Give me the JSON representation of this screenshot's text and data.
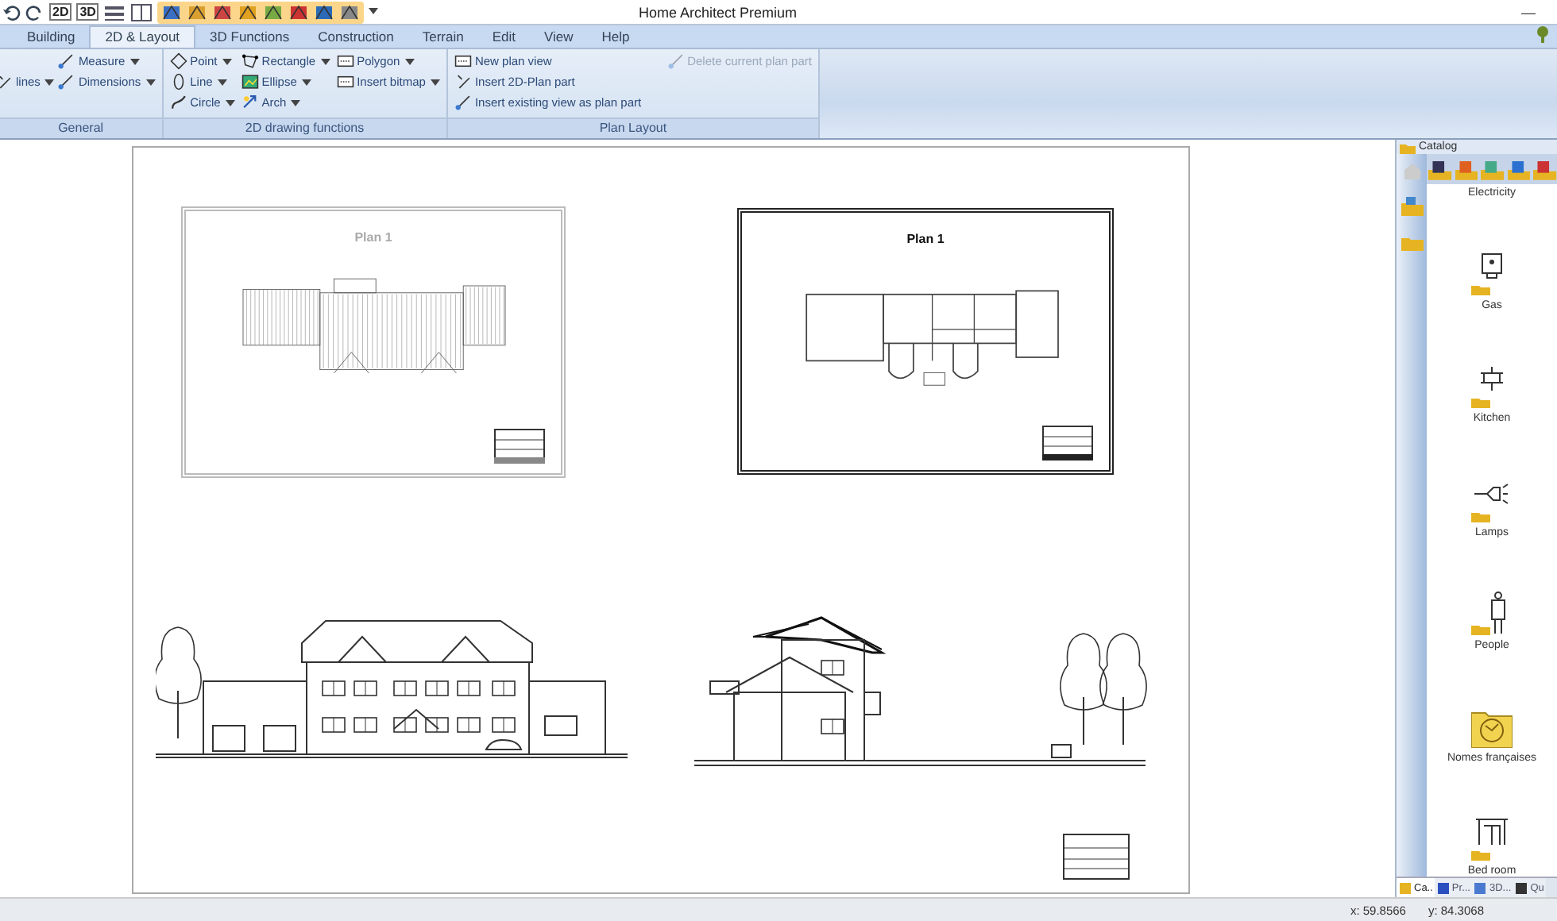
{
  "window": {
    "title": "Home Architect Premium",
    "minimize": "—"
  },
  "quick_access": {
    "labels": [
      "2D",
      "3D"
    ]
  },
  "tabs": [
    {
      "label": "Building",
      "selected": false
    },
    {
      "label": "2D & Layout",
      "selected": true
    },
    {
      "label": "3D Functions",
      "selected": false
    },
    {
      "label": "Construction",
      "selected": false
    },
    {
      "label": "Terrain",
      "selected": false
    },
    {
      "label": "Edit",
      "selected": false
    },
    {
      "label": "View",
      "selected": false
    },
    {
      "label": "Help",
      "selected": false
    }
  ],
  "ribbon_groups": [
    {
      "title": "General",
      "columns": [
        {
          "items": [
            {
              "label": "lines",
              "has_menu": true,
              "disabled": false
            }
          ]
        },
        {
          "items": [
            {
              "label": "Measure",
              "has_menu": true,
              "disabled": false
            },
            {
              "label": "Dimensions",
              "has_menu": true,
              "disabled": false
            }
          ]
        }
      ]
    },
    {
      "title": "2D drawing functions",
      "columns": [
        {
          "items": [
            {
              "label": "Point",
              "has_menu": true,
              "disabled": false
            },
            {
              "label": "Line",
              "has_menu": true,
              "disabled": false
            },
            {
              "label": "Circle",
              "has_menu": true,
              "disabled": false
            }
          ]
        },
        {
          "items": [
            {
              "label": "Rectangle",
              "has_menu": true,
              "disabled": false
            },
            {
              "label": "Ellipse",
              "has_menu": true,
              "disabled": false
            },
            {
              "label": "Arch",
              "has_menu": true,
              "disabled": false
            }
          ]
        },
        {
          "items": [
            {
              "label": "Polygon",
              "has_menu": true,
              "disabled": false
            },
            {
              "label": "Insert bitmap",
              "has_menu": true,
              "disabled": false
            }
          ]
        }
      ]
    },
    {
      "title": "Plan Layout",
      "columns": [
        {
          "items": [
            {
              "label": "New plan view",
              "has_menu": false,
              "disabled": false
            },
            {
              "label": "Insert 2D-Plan part",
              "has_menu": false,
              "disabled": false
            },
            {
              "label": "Insert existing view as plan part",
              "has_menu": false,
              "disabled": false
            }
          ]
        },
        {
          "items": [
            {
              "label": "Delete current plan part",
              "has_menu": false,
              "disabled": true
            }
          ]
        }
      ]
    }
  ],
  "plan_sheets": [
    {
      "title": "Plan 1",
      "selected": false
    },
    {
      "title": "Plan 1",
      "selected": true
    }
  ],
  "catalog": {
    "title": "Catalog",
    "items": [
      {
        "label": "Electricity"
      },
      {
        "label": "Gas"
      },
      {
        "label": "Kitchen"
      },
      {
        "label": "Lamps"
      },
      {
        "label": "People"
      },
      {
        "label": "Nomes françaises"
      },
      {
        "label": "Bed room"
      }
    ],
    "bottom_tabs": [
      {
        "label": "Ca..",
        "selected": true
      },
      {
        "label": "Pr...",
        "selected": false
      },
      {
        "label": "3D...",
        "selected": false
      },
      {
        "label": "Qu",
        "selected": false
      }
    ]
  },
  "status_bar": {
    "x": "x: 59.8566",
    "y": "y: 84.3068"
  }
}
